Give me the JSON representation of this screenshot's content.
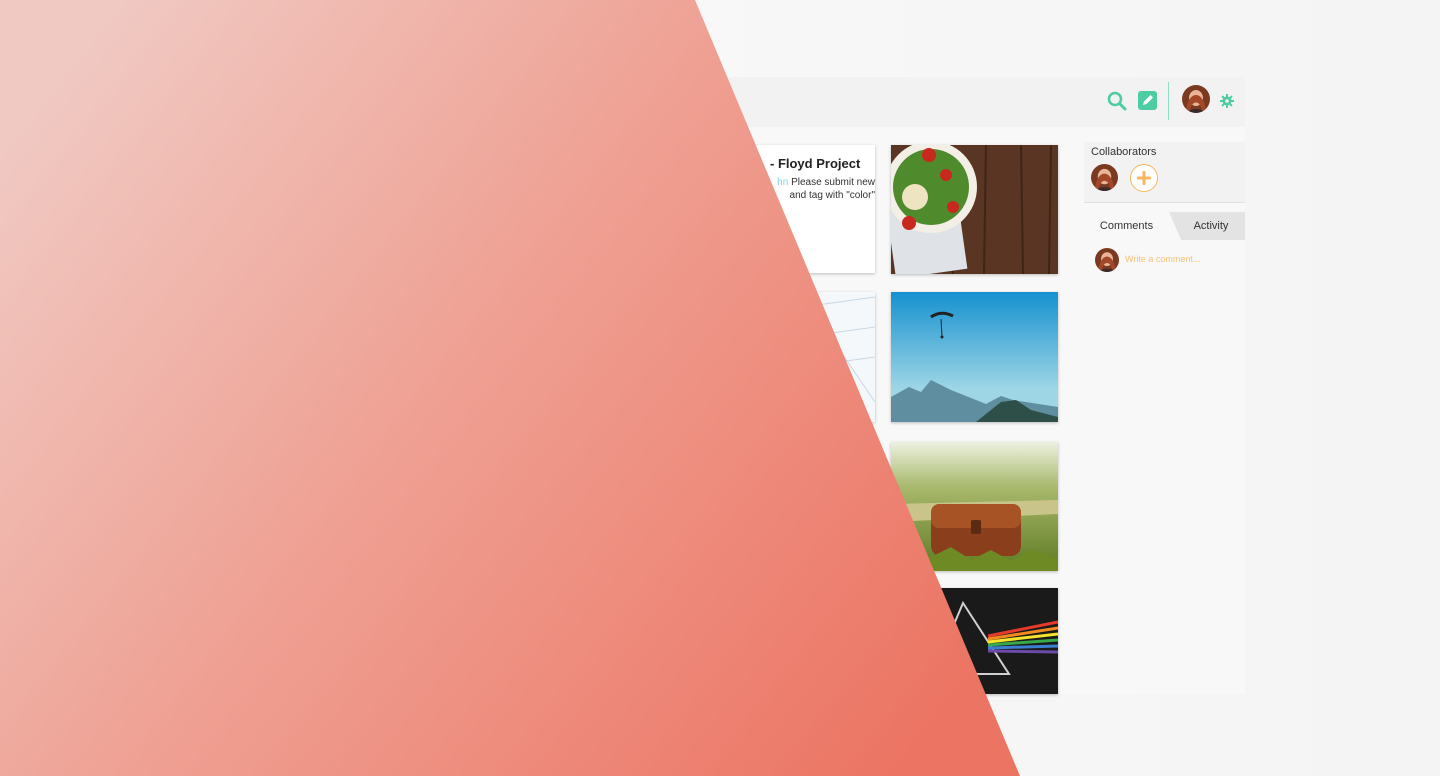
{
  "header": {
    "icons": [
      "search-icon",
      "edit-icon",
      "avatar",
      "gear-icon"
    ],
    "accent_color": "#4ecca3"
  },
  "project_card": {
    "title": "- Floyd Project",
    "mention": "hn",
    "message_line1": "Please submit new",
    "message_line2": "and tag with \"color\""
  },
  "gallery": {
    "images": [
      "salad-image",
      "paraglider-mountains-image",
      "leather-bag-field-image",
      "prism-rainbow-image"
    ]
  },
  "collaborators": {
    "title": "Collaborators",
    "add_color": "#f6b760"
  },
  "tabs": [
    {
      "label": "Comments",
      "active": true
    },
    {
      "label": "Activity",
      "active": false
    }
  ],
  "comment": {
    "placeholder": "Write a comment..."
  },
  "overlay": {
    "gradient_start": "#f0c9c2",
    "gradient_end": "#ec7463"
  }
}
